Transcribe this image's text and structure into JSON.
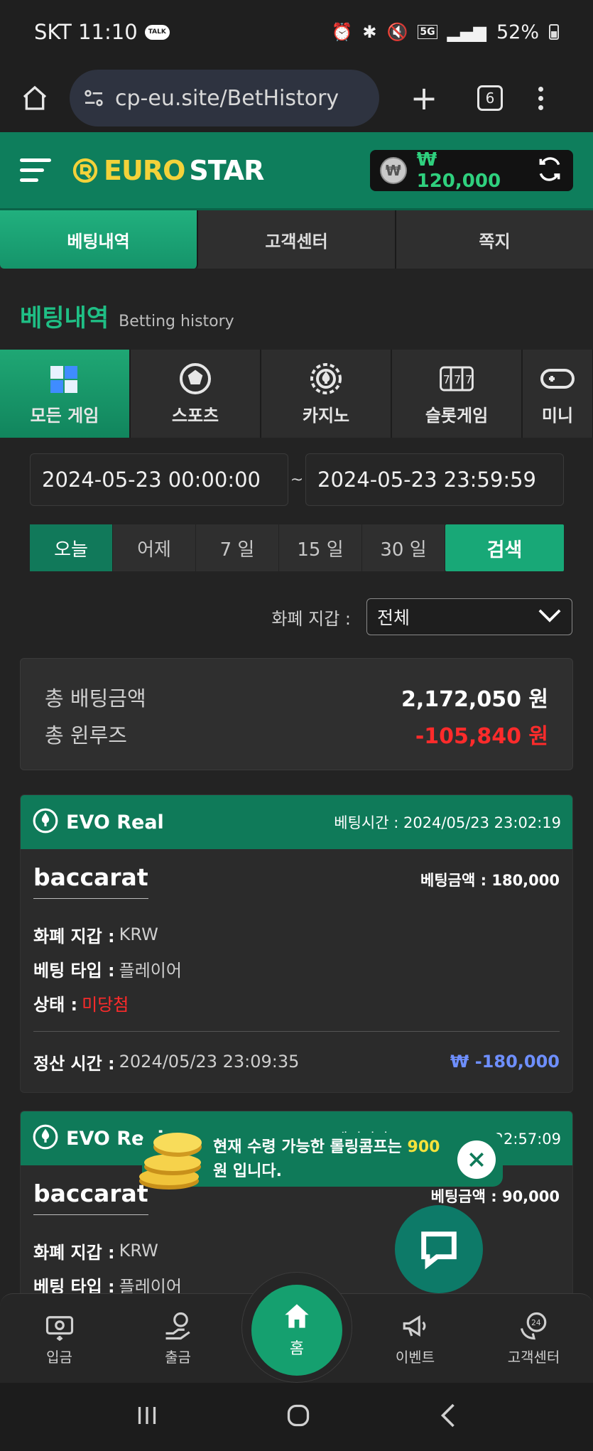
{
  "status_bar": {
    "carrier_time": "SKT 11:10",
    "talk": "TALK",
    "network": "5G",
    "battery": "52%"
  },
  "browser": {
    "url": "cp-eu.site/BetHistory",
    "tab_count": "6"
  },
  "header": {
    "logo_euro": "EURO",
    "logo_star": "STAR",
    "balance": "₩ 120,000",
    "currency_symbol": "₩"
  },
  "top_tabs": [
    {
      "label": "베팅내역"
    },
    {
      "label": "고객센터"
    },
    {
      "label": "쪽지"
    }
  ],
  "section": {
    "title_ko": "베팅내역",
    "title_en": "Betting history"
  },
  "categories": [
    {
      "label": "모든 게임",
      "icon": "grid-cubes-icon"
    },
    {
      "label": "스포츠",
      "icon": "soccer-ball-icon"
    },
    {
      "label": "카지노",
      "icon": "casino-chip-icon"
    },
    {
      "label": "슬롯게임",
      "icon": "slot-machine-icon"
    },
    {
      "label": "미니",
      "icon": "gamepad-icon"
    }
  ],
  "date_range": {
    "start": "2024-05-23 00:00:00",
    "separator": "~",
    "end": "2024-05-23 23:59:59"
  },
  "quick_ranges": [
    {
      "label": "오늘"
    },
    {
      "label": "어제"
    },
    {
      "label": "7 일"
    },
    {
      "label": "15 일"
    },
    {
      "label": "30 일"
    }
  ],
  "search_label": "검색",
  "currency_filter": {
    "label": "화폐 지갑 :",
    "selected": "전체"
  },
  "summary": {
    "total_bet_label": "총 배팅금액",
    "total_bet_value": "2,172,050 원",
    "total_winloss_label": "총 윈루즈",
    "total_winloss_value": "-105,840 원"
  },
  "bets": [
    {
      "provider": "EVO Real",
      "time": "베팅시간 : 2024/05/23 23:02:19",
      "game": "baccarat",
      "amount": "베팅금액 : 180,000",
      "currency_key": "화폐 지갑 :",
      "currency_val": "KRW",
      "type_key": "베팅 타입 :",
      "type_val": "플레이어",
      "status_key": "상태 :",
      "status_val": "미당첨",
      "settle_key": "정산 시간 :",
      "settle_val": "2024/05/23 23:09:35",
      "settle_amount": "₩ -180,000"
    },
    {
      "provider": "EVO Real",
      "time": "베팅시간 : 2024/05/23 22:57:09",
      "game": "baccarat",
      "amount": "베팅금액 : 90,000",
      "currency_key": "화폐 지갑 :",
      "currency_val": "KRW",
      "type_key": "베팅 타입 :",
      "type_val": "플레이어"
    }
  ],
  "toast": {
    "pre": "현재 수령 가능한 롤링콤프는 ",
    "highlight": "900",
    "post": " 원 입니다."
  },
  "bottom_nav": [
    {
      "label": "입금",
      "icon": "deposit-icon"
    },
    {
      "label": "출금",
      "icon": "withdraw-icon"
    },
    {
      "label": "홈",
      "icon": "home-icon"
    },
    {
      "label": "이벤트",
      "icon": "megaphone-icon"
    },
    {
      "label": "고객센터",
      "icon": "support-24-icon"
    }
  ],
  "colors": {
    "brand_green": "#0f7a59",
    "accent_green": "#18a877",
    "loss_red": "#ff2b2b",
    "settle_blue": "#6e8fff",
    "coin_yellow": "#f5e23b"
  }
}
